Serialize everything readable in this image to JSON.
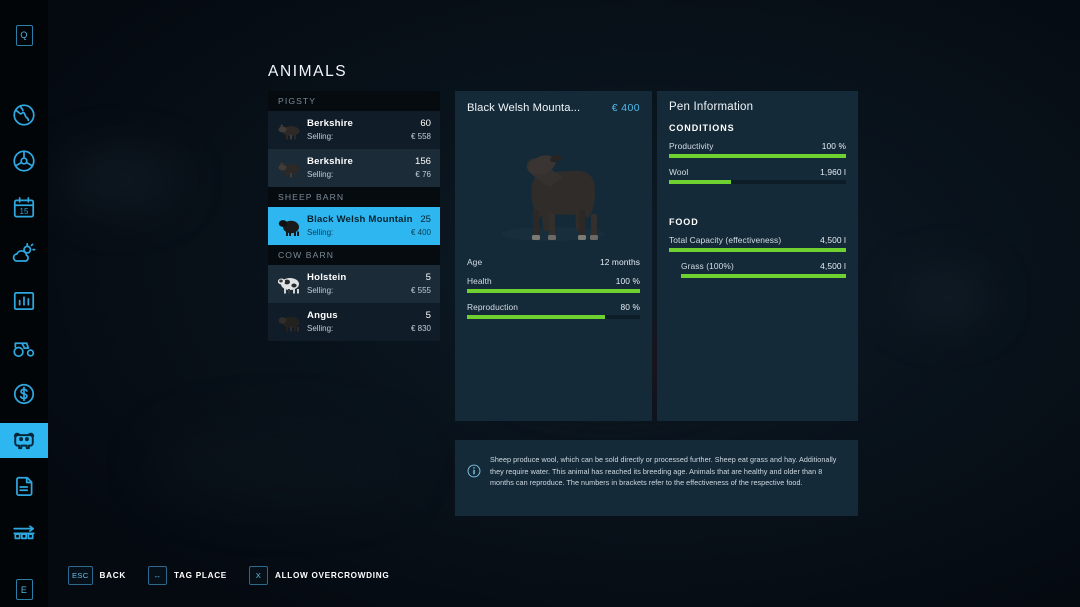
{
  "page": {
    "title": "ANIMALS"
  },
  "sidebar": {
    "items": [
      {
        "name": "help-key",
        "icon": "key-q",
        "label": "Q",
        "active": false
      },
      {
        "name": "map-globe",
        "icon": "globe",
        "label": "",
        "active": false
      },
      {
        "name": "vehicle-steering",
        "icon": "steering-wheel",
        "label": "",
        "active": false
      },
      {
        "name": "calendar",
        "icon": "calendar",
        "label": "15",
        "active": false
      },
      {
        "name": "weather",
        "icon": "weather-sun-cloud",
        "label": "",
        "active": false
      },
      {
        "name": "statistics",
        "icon": "bar-chart",
        "label": "",
        "active": false
      },
      {
        "name": "vehicles",
        "icon": "tractor",
        "label": "",
        "active": false
      },
      {
        "name": "finances",
        "icon": "dollar-coin",
        "label": "",
        "active": false
      },
      {
        "name": "animals",
        "icon": "cow",
        "label": "",
        "active": true
      },
      {
        "name": "contracts",
        "icon": "documents",
        "label": "",
        "active": false
      },
      {
        "name": "production",
        "icon": "production-chain",
        "label": "",
        "active": false
      },
      {
        "name": "construction-key",
        "icon": "key-e",
        "label": "E",
        "active": false
      }
    ]
  },
  "animal_list": {
    "groups": [
      {
        "header": "PIGSTY",
        "rows": [
          {
            "icon": "pig",
            "name": "Berkshire",
            "count": "60",
            "selling_label": "Selling:",
            "price": "€ 558",
            "selected": false
          },
          {
            "icon": "pig",
            "name": "Berkshire",
            "count": "156",
            "selling_label": "Selling:",
            "price": "€ 76",
            "selected": false
          }
        ]
      },
      {
        "header": "SHEEP BARN",
        "rows": [
          {
            "icon": "sheep",
            "name": "Black Welsh Mountain",
            "count": "25",
            "selling_label": "Selling:",
            "price": "€ 400",
            "selected": true
          }
        ]
      },
      {
        "header": "COW BARN",
        "rows": [
          {
            "icon": "cow-spotted",
            "name": "Holstein",
            "count": "5",
            "selling_label": "Selling:",
            "price": "€ 555",
            "selected": false
          },
          {
            "icon": "cow-black",
            "name": "Angus",
            "count": "5",
            "selling_label": "Selling:",
            "price": "€ 830",
            "selected": false
          }
        ]
      }
    ]
  },
  "detail": {
    "name": "Black Welsh Mounta...",
    "price": "€ 400",
    "stats": [
      {
        "label": "Age",
        "value": "12 months",
        "bar": false,
        "percent": 0
      },
      {
        "label": "Health",
        "value": "100 %",
        "bar": true,
        "percent": 100
      },
      {
        "label": "Reproduction",
        "value": "80 %",
        "bar": true,
        "percent": 80
      }
    ]
  },
  "pen": {
    "title": "Pen Information",
    "conditions_label": "CONDITIONS",
    "conditions": [
      {
        "label": "Productivity",
        "value": "100 %",
        "percent": 100,
        "indent": false
      },
      {
        "label": "Wool",
        "value": "1,960 l",
        "percent": 35,
        "indent": false
      }
    ],
    "food_label": "FOOD",
    "food": [
      {
        "label": "Total Capacity (effectiveness)",
        "value": "4,500 l",
        "percent": 100,
        "indent": false
      },
      {
        "label": "Grass (100%)",
        "value": "4,500 l",
        "percent": 100,
        "indent": true
      }
    ]
  },
  "info": {
    "icon": "info-circle-icon",
    "text": "Sheep produce wool, which can be sold directly or processed further. Sheep eat grass and hay. Additionally they require water. This animal has reached its breeding age. Animals that are healthy and older than 8 months can reproduce. The numbers in brackets refer to the effectiveness of the respective food."
  },
  "hints": [
    {
      "key": "ESC",
      "label": "BACK"
    },
    {
      "key": "↔",
      "label": "TAG PLACE"
    },
    {
      "key": "X",
      "label": "ALLOW OVERCROWDING"
    }
  ],
  "colors": {
    "accent": "#2eb6f0",
    "bar_green": "#6fd130",
    "panel_bg": "#152a38",
    "price_blue": "#4fb9e8"
  }
}
